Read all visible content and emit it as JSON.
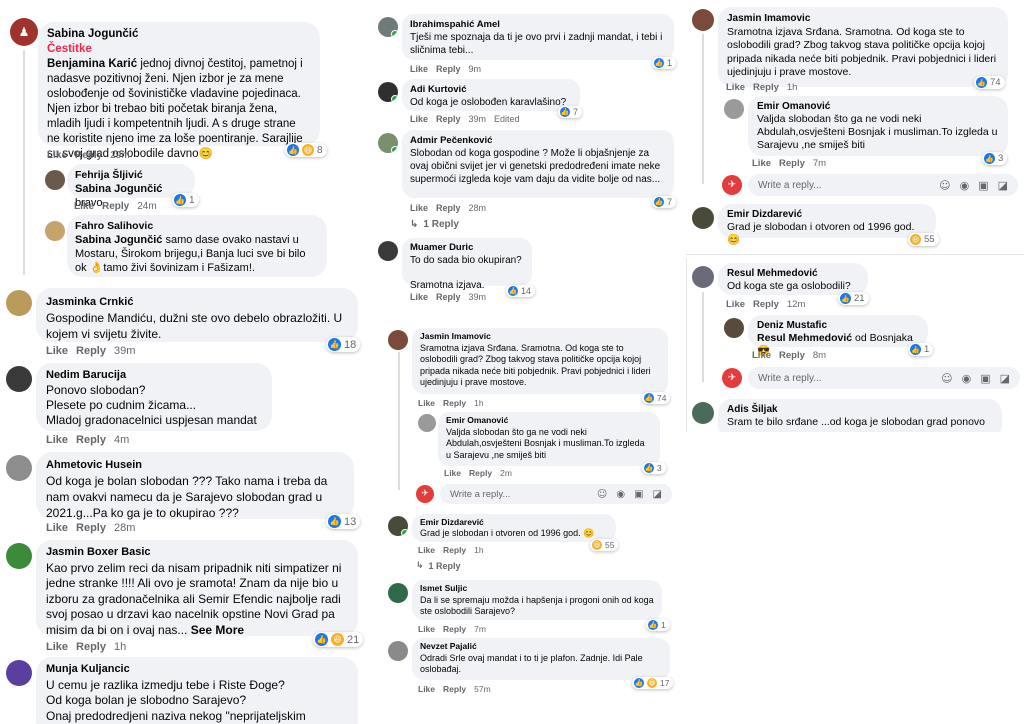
{
  "ui": {
    "like": "Like",
    "reply": "Reply",
    "see_more": "See More",
    "write_placeholder": "Write a reply...",
    "edited": "Edited"
  },
  "colors": {
    "bubble": "#f0f2f5",
    "meta": "#65676b",
    "like_blue": "#1877f2",
    "red_subtitle": "#f02849",
    "online": "#31a24c"
  },
  "col1": {
    "sabina": {
      "name": "Sabina Jogunčić",
      "subtitle": "Čestitke",
      "tag": "Benjamina Karić",
      "text": " jednoj divnoj čestitoj, pametnoj i nadasve pozitivnoj ženi. Njen izbor je za mene oslobođenje od šovinističke vladavine pojedinaca. Njen izbor bi trebao biti početak biranja žena, mladih ljudi i kompetentnih ljudi. A s druge strane ne koristite njeno ime za loše poentiranje. Sarajlije su svoj grad oslobodile davno😊",
      "time": "29m",
      "reactions": "8"
    },
    "fehrija": {
      "name": "Fehrija Šljivić",
      "tag": "Sabina Jogunčić",
      "text": " bravo.",
      "time": "24m",
      "reactions": "1"
    },
    "fahro": {
      "name": "Fahro Salihovic",
      "tag": "Sabina Jogunčić",
      "text": " samo dase ovako nastavi u Mostaru, Širokom brijegu,i Banja luci sve bi bilo ok 👌tamo živi šovinizam i Fašizam!."
    },
    "jasminka": {
      "name": "Jasminka Crnkić",
      "text": "Gospodine Mandiću, dužni ste ovo debelo obrazložiti. U kojem vi svijetu živite.",
      "time": "39m",
      "reactions": "18"
    },
    "nedim": {
      "name": "Nedim Barucija",
      "text": "Ponovo slobodan?\nPlesete po cudnim žicama...\nMladoj gradonacelnici uspjesan mandat",
      "time": "4m"
    },
    "ahmetovic": {
      "name": "Ahmetovic Husein",
      "text": "Od koga je bolan slobodan ??? Tako nama i treba da nam ovakvi namecu da je Sarajevo slobodan grad u 2021.g...Pa ko ga je to okupirao ???",
      "time": "28m",
      "reactions": "13"
    },
    "jasmin_boxer": {
      "name": "Jasmin Boxer Basic",
      "text": "Kao prvo zelim reci da nisam pripadnik niti simpatizer ni jedne stranke !!!! Ali ovo je sramota! Znam da nije bio u izboru za gradonačelnika ali Semir Efendic najbolje radi svoj posao u drzavi kao nacelnik opstine Novi Grad pa misim da bi on i ovaj nas...",
      "time": "1h",
      "reactions": "21"
    },
    "munja": {
      "name": "Munja Kuljancic",
      "text": "U cemu je razlika izmedju tebe i Riste Đoge?\nOd koga bolan je slobodno Sarajevo?\nOnaj predodredjeni naziva nekog \"neprijateljskim"
    }
  },
  "col2": {
    "ibrahim": {
      "name": "Ibrahimspahić Amel",
      "text": "Tješi me spoznaja da ti je ovo prvi i zadnji mandat, i tebi i sličnima tebi...",
      "time": "9m",
      "reactions": "1"
    },
    "adi": {
      "name": "Adi Kurtović",
      "text": "Od koga je oslobođen karavlašino?",
      "time": "39m",
      "reactions": "7"
    },
    "admir": {
      "name": "Admir Pečenković",
      "text": "Slobodan od koga gospodine ? Može li objašnjenje za ovaj obični svijet jer vi genetski predodređeni imate neke supermoći izgleda koje vam daju da vidite bolje od nas...",
      "time": "28m",
      "reactions": "7",
      "replies": "1 Reply"
    },
    "muamer": {
      "name": "Muamer Duric",
      "text": "To do sada bio okupiran?\n\nSramotna izjava.",
      "time": "39m",
      "reactions": "14"
    },
    "jasmin_i": {
      "name": "Jasmin Imamovic",
      "text": "Sramotna izjava Srđana. Sramotna. Od koga ste to oslobodili grad? Zbog takvog stava političke opcija kojoj pripada nikada neće biti pobjednik. Pravi pobjednici i lideri ujedinjuju i prave mostove.",
      "time": "1h",
      "reactions": "74"
    },
    "emir_o": {
      "name": "Emir Omanović",
      "text": "Valjda slobodan što ga ne vodi neki Abdulah,osvješteni Bosnjak i musliman.To izgleda u Sarajevu ,ne smiješ biti",
      "time": "2m",
      "reactions": "3"
    },
    "emir_d": {
      "name": "Emir Dizdarević",
      "text": "Grad je slobodan i otvoren od 1996 god. 😊",
      "time": "1h",
      "reactions": "55",
      "replies": "1 Reply"
    },
    "ismet": {
      "name": "Ismet Suljic",
      "text": "Da li se spremaju možda i hapšenja i progoni onih od koga ste oslobodili Sarajevo?",
      "time": "7m",
      "reactions": "1"
    },
    "nevzet": {
      "name": "Nevzet Pajalić",
      "text": "Odradi Srle ovaj mandat i to ti je plafon. Zadnje. Idi Pale oslobađaj.",
      "time": "57m",
      "reactions": "17"
    }
  },
  "col3": {
    "jasmin_i": {
      "name": "Jasmin Imamovic",
      "text": "Sramotna izjava Srđana. Sramotna. Od koga ste to oslobodili grad? Zbog takvog stava političke opcija kojoj pripada nikada neće biti pobjednik. Pravi pobjednici i lideri ujedinjuju i prave mostove.",
      "time": "1h",
      "reactions": "74"
    },
    "emir_o": {
      "name": "Emir Omanović",
      "text": "Valjda slobodan što ga ne vodi neki Abdulah,osvješteni Bosnjak i musliman.To izgleda u Sarajevu ,ne smiješ biti",
      "time": "7m",
      "reactions": "3"
    },
    "emir_d": {
      "name": "Emir Dizdarević",
      "text": "Grad je slobodan i otvoren od 1996 god. 😊",
      "reactions": "55"
    },
    "resul": {
      "name": "Resul Mehmedović",
      "text": "Od koga ste ga oslobodili?",
      "time": "12m",
      "reactions": "21"
    },
    "deniz": {
      "name": "Deniz Mustafic",
      "tag": "Resul Mehmedović",
      "text": " od Bosnjaka 😎",
      "time": "8m",
      "reactions": "1"
    },
    "adis": {
      "name": "Adis Šiljak",
      "text": "Sram te bilo srđane ...od koga je slobodan grad ponovo"
    }
  }
}
